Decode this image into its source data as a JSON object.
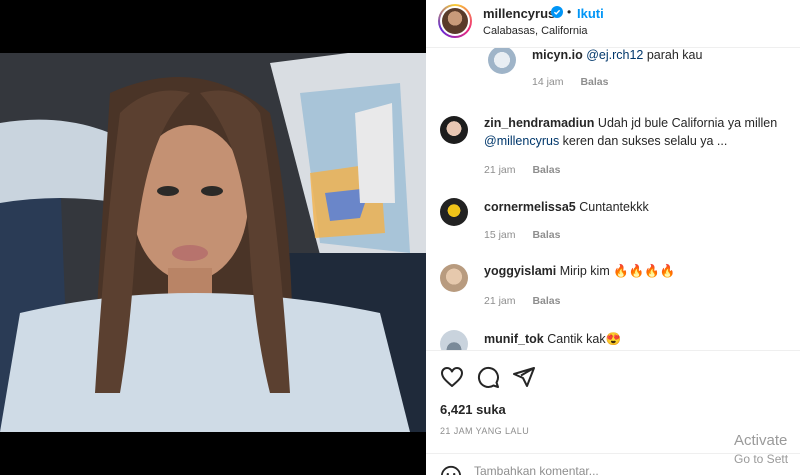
{
  "header": {
    "username": "millencyrus",
    "separator": "•",
    "follow_label": "Ikuti",
    "location": "Calabasas, California"
  },
  "comments": [
    {
      "user": "micyn.io",
      "text": "",
      "mention": "@ej.rch12",
      "after": " parah kau",
      "time": "14 jam",
      "reply": "Balas"
    },
    {
      "user": "zin_hendramadiun",
      "text": "Udah jd bule California ya millen",
      "mention": "@millencyrus",
      "after": " keren dan sukses selalu ya ...",
      "time": "21 jam",
      "reply": "Balas"
    },
    {
      "user": "cornermelissa5",
      "text": "Cuntantekkk",
      "time": "15 jam",
      "reply": "Balas"
    },
    {
      "user": "yoggyislami",
      "text": "Mirip kim 🔥🔥🔥🔥",
      "time": "21 jam",
      "reply": "Balas"
    },
    {
      "user": "munif_tok",
      "text": "Cantik kak😍"
    }
  ],
  "actions": {
    "icons": [
      "heart-icon",
      "comment-icon",
      "share-icon"
    ],
    "likes": "6,421 suka",
    "time_ago": "21 JAM YANG LALU",
    "comment_placeholder": "Tambahkan komentar..."
  },
  "watermark": {
    "line1": "Activate",
    "line2": "Go to Sett"
  },
  "colors": {
    "accent": "#0095f6",
    "mention": "#00376b",
    "muted": "#8e8e8e"
  }
}
